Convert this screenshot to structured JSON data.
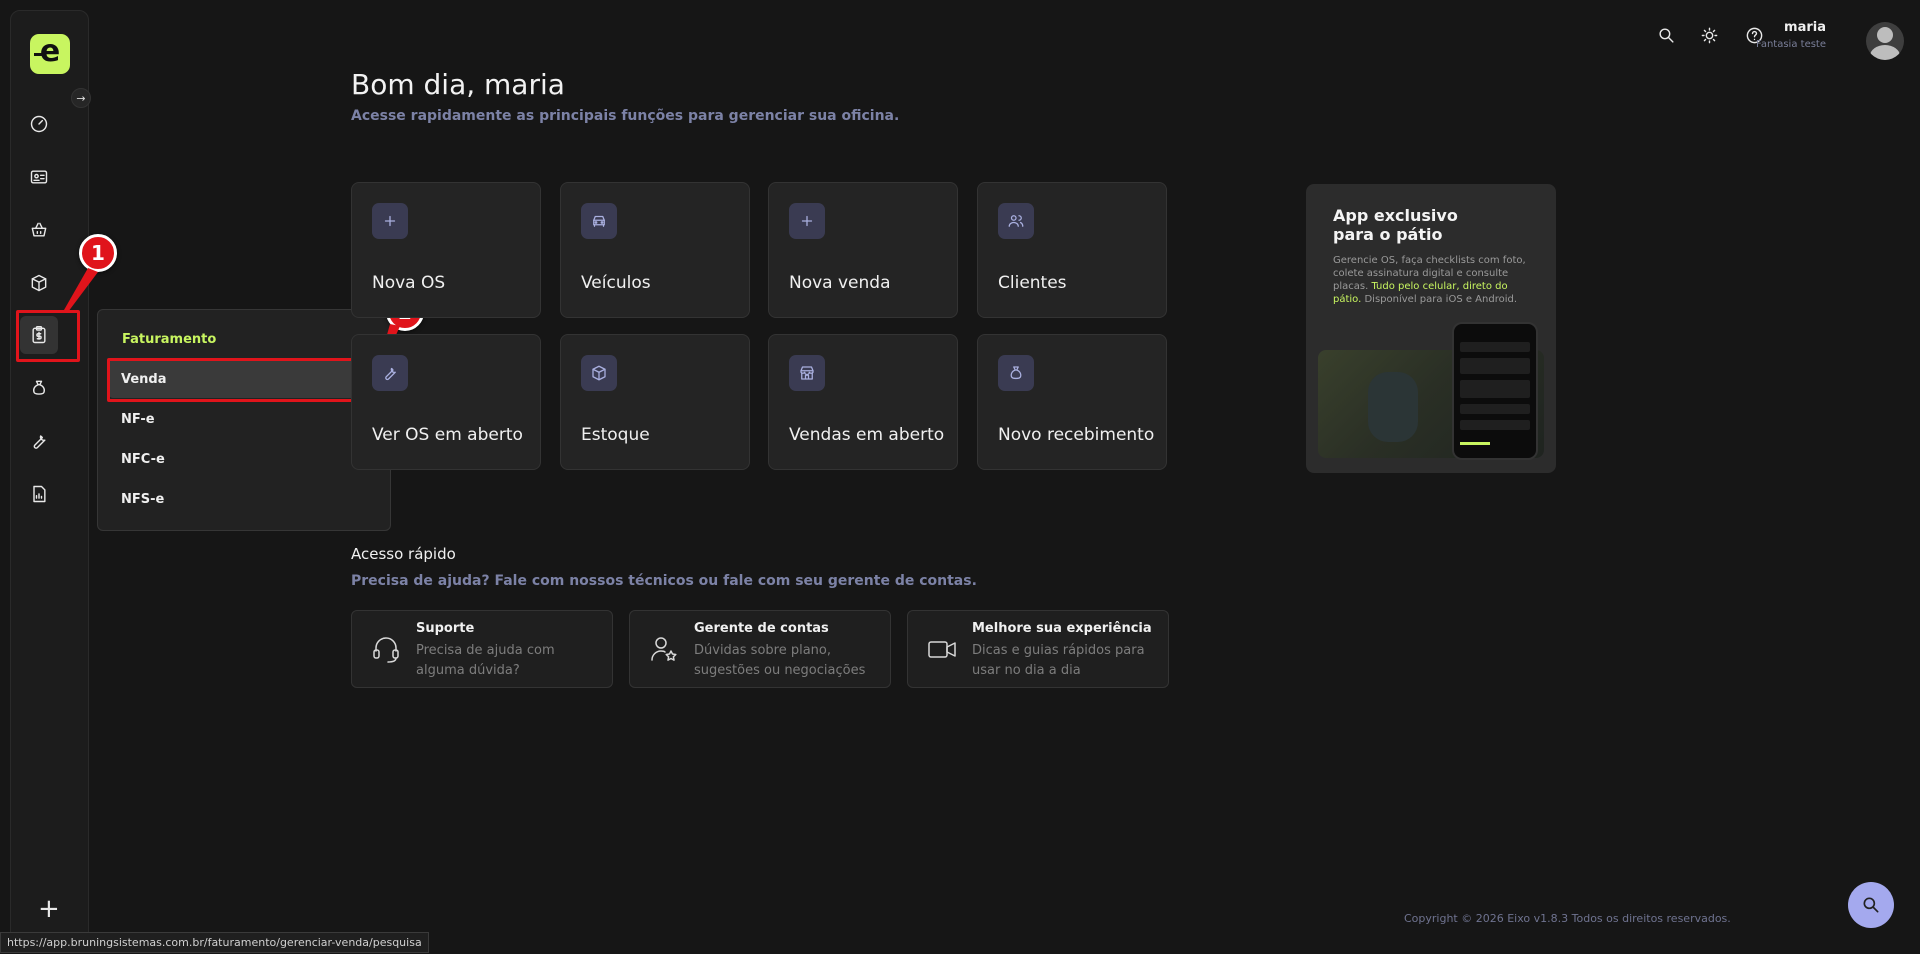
{
  "user": {
    "name": "maria",
    "company": "Fantasia teste"
  },
  "greeting": {
    "title": "Bom dia, maria",
    "subtitle": "Acesse rapidamente as principais funções para gerenciar sua oficina."
  },
  "cards": [
    {
      "label": "Nova OS",
      "icon": "plus-icon"
    },
    {
      "label": "Veículos",
      "icon": "car-icon"
    },
    {
      "label": "Nova venda",
      "icon": "plus-icon"
    },
    {
      "label": "Clientes",
      "icon": "users-icon"
    },
    {
      "label": "Ver OS em aberto",
      "icon": "wrench-icon"
    },
    {
      "label": "Estoque",
      "icon": "box-icon"
    },
    {
      "label": "Vendas em aberto",
      "icon": "store-icon"
    },
    {
      "label": "Novo recebimento",
      "icon": "money-bag-icon"
    }
  ],
  "flyout": {
    "header": "Faturamento",
    "items": [
      "Venda",
      "NF-e",
      "NFC-e",
      "NFS-e"
    ]
  },
  "promo": {
    "title": "App exclusivo para o pátio",
    "text_before": "Gerencie OS, faça checklists com foto, colete assinatura digital e consulte placas. ",
    "text_highlight": "Tudo pelo celular, direto do pátio.",
    "text_after": " Disponível para iOS e Android."
  },
  "quick_access": {
    "title": "Acesso rápido",
    "subtitle": "Precisa de ajuda? Fale com nossos técnicos ou fale com seu gerente de contas.",
    "items": [
      {
        "title": "Suporte",
        "desc": "Precisa de ajuda com alguma dúvida?",
        "icon": "headset-icon"
      },
      {
        "title": "Gerente de contas",
        "desc": "Dúvidas sobre plano, sugestões ou negociações",
        "icon": "user-star-icon"
      },
      {
        "title": "Melhore sua experiência",
        "desc": "Dicas e guias rápidos para usar no dia a dia",
        "icon": "video-icon"
      }
    ]
  },
  "annotations": {
    "step1": "1",
    "step2": "2"
  },
  "footer": "Copyright © 2026 Eixo v1.8.3 Todos os direitos reservados.",
  "status_url": "https://app.bruningsistemas.com.br/faturamento/gerenciar-venda/pesquisa",
  "colors": {
    "accent": "#c8f560",
    "highlight": "#e0141b",
    "icon_bg": "#3a3b52",
    "fab": "#a4a9ee"
  }
}
